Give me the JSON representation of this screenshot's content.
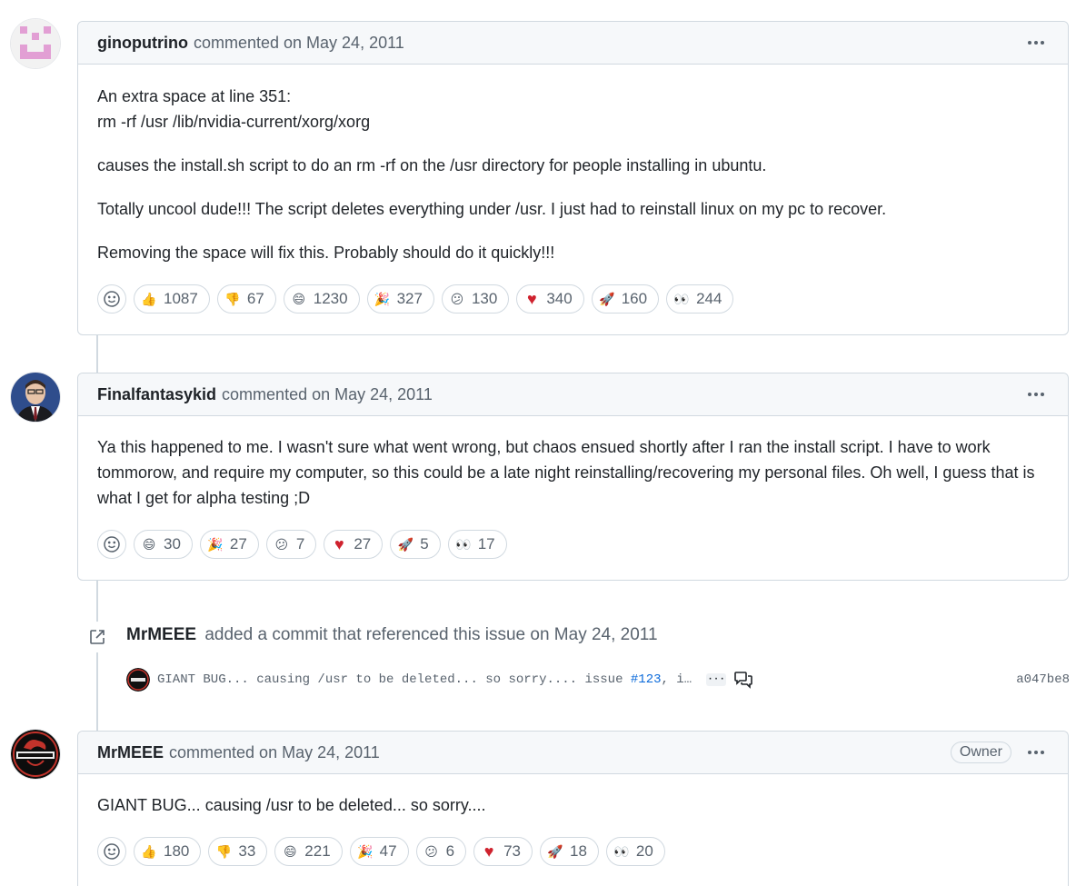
{
  "comments": [
    {
      "author": "ginoputrino",
      "meta": "commented on May 24, 2011",
      "paragraphs": [
        "An extra space at line 351:",
        "rm -rf /usr /lib/nvidia-current/xorg/xorg",
        "causes the install.sh script to do an rm -rf on the /usr directory for people installing in ubuntu.",
        "Totally uncool dude!!! The script deletes everything under /usr. I just had to reinstall linux on my pc to recover.",
        "Removing the space will fix this. Probably should do it quickly!!!"
      ],
      "reactions": [
        {
          "emoji": "thumbs-up",
          "count": "1087"
        },
        {
          "emoji": "thumbs-down",
          "count": "67"
        },
        {
          "emoji": "laugh",
          "count": "1230"
        },
        {
          "emoji": "hooray",
          "count": "327"
        },
        {
          "emoji": "confused",
          "count": "130"
        },
        {
          "emoji": "heart",
          "count": "340"
        },
        {
          "emoji": "rocket",
          "count": "160"
        },
        {
          "emoji": "eyes",
          "count": "244"
        }
      ]
    },
    {
      "author": "Finalfantasykid",
      "meta": "commented on May 24, 2011",
      "paragraphs": [
        "Ya this happened to me. I wasn't sure what went wrong, but chaos ensued shortly after I ran the install script. I have to work tommorow, and require my computer, so this could be a late night reinstalling/recovering my personal files. Oh well, I guess that is what I get for alpha testing ;D"
      ],
      "reactions": [
        {
          "emoji": "laugh",
          "count": "30"
        },
        {
          "emoji": "hooray",
          "count": "27"
        },
        {
          "emoji": "confused",
          "count": "7"
        },
        {
          "emoji": "heart",
          "count": "27"
        },
        {
          "emoji": "rocket",
          "count": "5"
        },
        {
          "emoji": "eyes",
          "count": "17"
        }
      ]
    },
    {
      "author": "MrMEEE",
      "meta": "commented on May 24, 2011",
      "badge": "Owner",
      "paragraphs": [
        "GIANT BUG... causing /usr to be deleted... so sorry...."
      ],
      "reactions": [
        {
          "emoji": "thumbs-up",
          "count": "180"
        },
        {
          "emoji": "thumbs-down",
          "count": "33"
        },
        {
          "emoji": "laugh",
          "count": "221"
        },
        {
          "emoji": "hooray",
          "count": "47"
        },
        {
          "emoji": "confused",
          "count": "6"
        },
        {
          "emoji": "heart",
          "count": "73"
        },
        {
          "emoji": "rocket",
          "count": "18"
        },
        {
          "emoji": "eyes",
          "count": "20"
        }
      ]
    }
  ],
  "event": {
    "author": "MrMEEE",
    "text": "added a commit that referenced this issue on May 24, 2011",
    "commit": {
      "message_prefix": "GIANT BUG... causing /usr to be deleted... so sorry.... issue ",
      "issue_link": "#123",
      "message_suffix": ", i…",
      "ellipsis": "···",
      "sha": "a047be8"
    }
  },
  "emoji_glyphs": {
    "thumbs-up": "👍",
    "thumbs-down": "👎",
    "laugh": "😄",
    "hooray": "🎉",
    "confused": "😕",
    "heart": "♥",
    "rocket": "🚀",
    "eyes": "👀"
  }
}
